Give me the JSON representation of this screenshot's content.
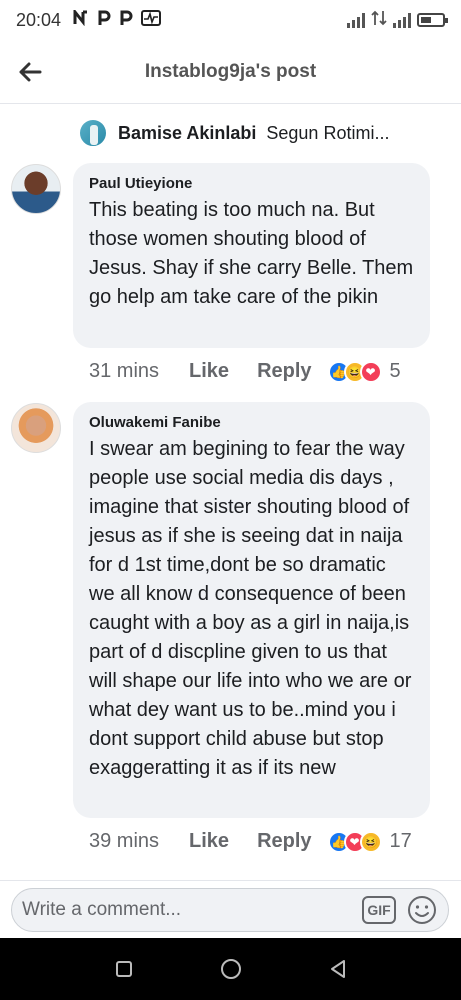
{
  "status_bar": {
    "time": "20:04",
    "notif_icons": [
      "n-icon",
      "p-icon",
      "p-icon",
      "pulse-icon"
    ],
    "right_icons": [
      "signal-icon",
      "data-icon",
      "signal-icon",
      "battery-icon"
    ]
  },
  "header": {
    "title": "Instablog9ja's post",
    "back_icon": "arrow-left-icon"
  },
  "reacted_by": {
    "name": "Bamise Akinlabi",
    "reply_to": "Segun Rotimi..."
  },
  "comments": [
    {
      "author": "Paul Utieyione",
      "text": "This beating is too much na. But those women shouting blood of Jesus. Shay if she carry Belle. Them go help am take care of the pikin",
      "time": "31 mins",
      "like_label": "Like",
      "reply_label": "Reply",
      "reactions": [
        "like",
        "haha",
        "love"
      ],
      "reaction_count": "5"
    },
    {
      "author": "Oluwakemi Fanibe",
      "text": "I swear am begining to fear the way people use social media dis days , imagine that sister shouting blood of jesus as if she is seeing dat in naija for d 1st time,dont be so dramatic we all know d consequence of  been caught with a boy as a girl in naija,is part of d discpline given to us that will shape our life into who we are or what dey want us to be..mind you i dont support child abuse but stop exaggeratting it as if its new",
      "time": "39 mins",
      "like_label": "Like",
      "reply_label": "Reply",
      "reactions": [
        "like",
        "love",
        "haha"
      ],
      "reaction_count": "17"
    }
  ],
  "composer": {
    "placeholder": "Write a comment...",
    "gif_label": "GIF",
    "emoji_icon": "smiley-icon"
  },
  "navbar": {
    "icons": [
      "recents-icon",
      "home-icon",
      "back-icon"
    ]
  },
  "colors": {
    "like_blue": "#1877f2",
    "haha_yellow": "#f7b928",
    "love_red": "#f33e58",
    "bubble_gray": "#f0f2f5",
    "meta_gray": "#65676b"
  }
}
